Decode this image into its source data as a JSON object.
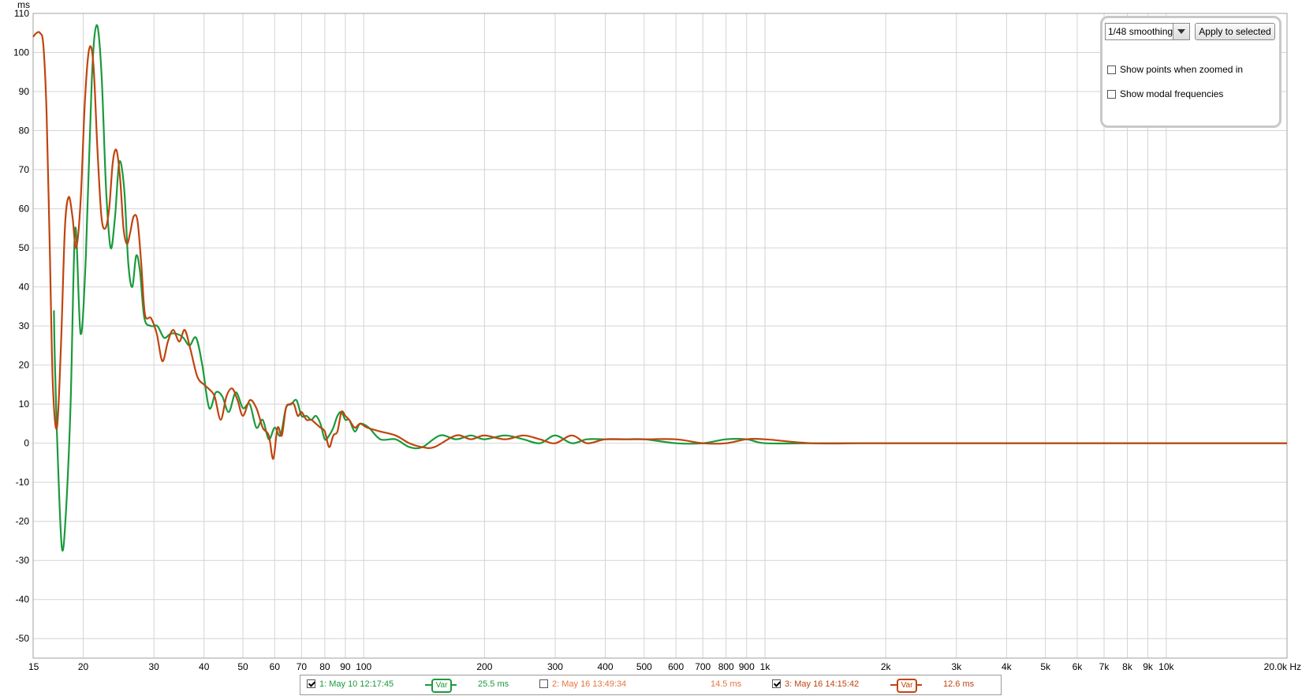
{
  "chart_data": {
    "type": "line",
    "ylabel": "ms",
    "xunit": "Hz",
    "xscale": "log",
    "xlim": [
      15,
      20000
    ],
    "ylim": [
      -55,
      110
    ],
    "yticks": [
      110,
      100,
      90,
      80,
      70,
      60,
      50,
      40,
      30,
      20,
      10,
      0,
      -10,
      -20,
      -30,
      -40,
      -50
    ],
    "xticks": [
      {
        "v": 15,
        "label": "15"
      },
      {
        "v": 20,
        "label": "20"
      },
      {
        "v": 30,
        "label": "30"
      },
      {
        "v": 40,
        "label": "40"
      },
      {
        "v": 50,
        "label": "50"
      },
      {
        "v": 60,
        "label": "60"
      },
      {
        "v": 70,
        "label": "70"
      },
      {
        "v": 80,
        "label": "80"
      },
      {
        "v": 90,
        "label": "90"
      },
      {
        "v": 100,
        "label": "100"
      },
      {
        "v": 200,
        "label": "200"
      },
      {
        "v": 300,
        "label": "300"
      },
      {
        "v": 400,
        "label": "400"
      },
      {
        "v": 500,
        "label": "500"
      },
      {
        "v": 600,
        "label": "600"
      },
      {
        "v": 700,
        "label": "700"
      },
      {
        "v": 800,
        "label": "800"
      },
      {
        "v": 900,
        "label": "900"
      },
      {
        "v": 1000,
        "label": "1k"
      },
      {
        "v": 2000,
        "label": "2k"
      },
      {
        "v": 3000,
        "label": "3k"
      },
      {
        "v": 4000,
        "label": "4k"
      },
      {
        "v": 5000,
        "label": "5k"
      },
      {
        "v": 6000,
        "label": "6k"
      },
      {
        "v": 7000,
        "label": "7k"
      },
      {
        "v": 8000,
        "label": "8k"
      },
      {
        "v": 9000,
        "label": "9k"
      },
      {
        "v": 10000,
        "label": "10k"
      },
      {
        "v": 20000,
        "label": "20.0k Hz"
      }
    ],
    "grid": true,
    "series": [
      {
        "name": "1: May 10 12:17:45",
        "color": "#1a9a3c",
        "x": [
          16.9,
          17.0,
          17.3,
          17.7,
          18.1,
          18.6,
          19.1,
          19.7,
          20.3,
          21.0,
          21.6,
          22.2,
          22.8,
          23.4,
          24.0,
          24.6,
          25.3,
          25.9,
          26.5,
          27.1,
          27.7,
          28.4,
          29.5,
          30.6,
          31.8,
          33.0,
          34.2,
          35.5,
          36.8,
          38.2,
          39.6,
          41.2,
          42.8,
          44.4,
          46.1,
          48.0,
          50.0,
          52.0,
          54.0,
          56.0,
          58.0,
          60.0,
          62.0,
          64.0,
          66.0,
          68.0,
          70.0,
          72.0,
          74.0,
          76.0,
          78.0,
          80.0,
          82.0,
          84.0,
          86.0,
          88.0,
          90.0,
          92.0,
          95.0,
          98.0,
          103.0,
          110.0,
          120.0,
          130.0,
          140.0,
          155.0,
          170.0,
          185.0,
          200.0,
          225.0,
          250.0,
          275.0,
          300.0,
          330.0,
          360.0,
          400.0,
          450.0,
          500.0,
          600.0,
          700.0,
          800.0,
          900.0,
          1000.0,
          1300.0,
          1700.0,
          2000.0,
          3000.0,
          5000.0,
          10000.0,
          20000.0
        ],
        "values": [
          34,
          20,
          -5,
          -27,
          -18,
          10,
          55,
          28,
          48,
          93,
          107,
          95,
          65,
          50,
          58,
          72,
          65,
          46,
          40,
          48,
          44,
          32,
          30,
          30,
          27,
          28,
          28,
          27,
          25,
          27,
          20,
          9,
          13,
          12,
          8,
          13,
          9,
          10,
          4,
          6,
          1,
          4,
          2,
          9,
          10,
          11,
          7,
          7,
          6,
          7,
          5,
          1,
          2,
          4,
          7,
          8,
          6,
          6,
          3,
          5,
          4,
          1,
          1,
          -1,
          -1,
          2,
          1,
          2,
          1,
          2,
          1,
          0,
          2,
          0,
          1,
          1,
          1,
          1,
          0,
          0,
          1,
          1,
          0,
          0,
          0,
          0,
          0,
          0,
          0,
          0
        ],
        "unit_value": "25.5 ms",
        "checked": true
      },
      {
        "name": "3: May 16 14:15:42",
        "color": "#c0440f",
        "x": [
          15.0,
          15.3,
          15.6,
          15.9,
          16.2,
          16.5,
          16.8,
          17.2,
          17.6,
          18.0,
          18.4,
          18.8,
          19.2,
          19.7,
          20.2,
          20.7,
          21.2,
          21.7,
          22.2,
          22.7,
          23.2,
          23.7,
          24.2,
          24.7,
          25.2,
          25.7,
          26.2,
          26.7,
          27.3,
          27.9,
          28.5,
          29.5,
          30.5,
          31.5,
          32.5,
          33.5,
          34.7,
          35.8,
          37.0,
          38.5,
          40.0,
          41.0,
          42.5,
          44.0,
          45.5,
          47.0,
          48.5,
          50.0,
          52.0,
          54.0,
          56.0,
          58.0,
          59.5,
          61.0,
          62.5,
          64.0,
          65.5,
          67.0,
          68.5,
          70.0,
          72.0,
          74.0,
          76.0,
          78.0,
          80.0,
          82.0,
          84.0,
          86.0,
          88.0,
          90.0,
          92.0,
          95.0,
          98.0,
          102.0,
          110.0,
          120.0,
          130.0,
          140.0,
          150.0,
          170.0,
          185.0,
          200.0,
          225.0,
          250.0,
          275.0,
          300.0,
          330.0,
          360.0,
          400.0,
          450.0,
          500.0,
          600.0,
          700.0,
          800.0,
          900.0,
          1000.0,
          1300.0,
          1700.0,
          2000.0,
          3000.0,
          5000.0,
          10000.0,
          20000.0
        ],
        "values": [
          104,
          105,
          105,
          102,
          85,
          50,
          15,
          4,
          25,
          55,
          63,
          58,
          50,
          62,
          88,
          101,
          97,
          75,
          58,
          55,
          60,
          72,
          75,
          68,
          55,
          51,
          54,
          58,
          57,
          46,
          33,
          32,
          28,
          21,
          26,
          29,
          26,
          29,
          24,
          17,
          15,
          14,
          12,
          6,
          12,
          14,
          11,
          7,
          11,
          9,
          4,
          2,
          -4,
          4,
          2,
          9,
          10,
          10,
          7,
          8,
          6,
          6,
          5,
          4,
          3,
          -1,
          2,
          3,
          8,
          7,
          6,
          4,
          5,
          4,
          3,
          2,
          0,
          -1,
          -1,
          2,
          1,
          2,
          1,
          2,
          1,
          0,
          2,
          0,
          1,
          1,
          1,
          1,
          0,
          0,
          1,
          1,
          0,
          0,
          0,
          0,
          0,
          0,
          0
        ],
        "unit_value": "12.6 ms",
        "checked": true
      }
    ]
  },
  "legend": {
    "items": [
      {
        "label": "1: May 10 12:17:45",
        "checked": true,
        "value": "25.5 ms",
        "color": "#1a9a3c",
        "has_var": true
      },
      {
        "label": "2: May 16 13:49:34",
        "checked": false,
        "value": "14.5 ms",
        "color": "#e8743c",
        "has_var": false
      },
      {
        "label": "3: May 16 14:15:42",
        "checked": true,
        "value": "12.6 ms",
        "color": "#c0440f",
        "has_var": true
      }
    ],
    "var_label": "Var"
  },
  "controls": {
    "smoothing_value": "1/48 smoothing",
    "apply_label": "Apply to selected",
    "show_points_label": "Show points when zoomed in",
    "show_modal_label": "Show modal frequencies",
    "show_points_checked": false,
    "show_modal_checked": false
  },
  "icons": {
    "dropdown": "chevron-down-icon",
    "checkbox": "checkbox-icon"
  }
}
